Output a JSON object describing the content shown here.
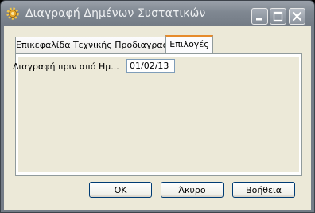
{
  "window": {
    "title": "Διαγραφή Δημένων Συστατικών",
    "icon": "gear-icon"
  },
  "tabs": [
    {
      "label": "Επικεφαλίδα Τεχνικής Προδιαγραφής",
      "active": false
    },
    {
      "label": "Επιλογές",
      "active": true
    }
  ],
  "form": {
    "delete_before_label": "Διαγραφή πριν από Ημ...",
    "delete_before_value": "01/02/13"
  },
  "buttons": {
    "ok": "OK",
    "cancel": "Άκυρο",
    "help": "Βοήθεια"
  },
  "colors": {
    "active_tab_accent": "#e68b2c",
    "dialog_background": "#ece9d8",
    "titlebar": "#7f8791"
  }
}
